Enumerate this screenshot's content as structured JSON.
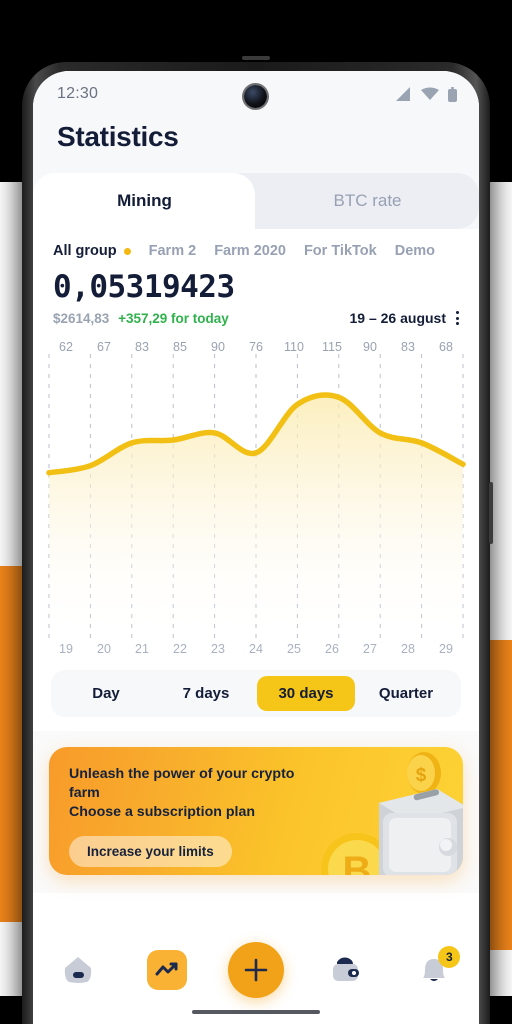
{
  "status_bar": {
    "time": "12:30",
    "signal_icon": "signal-icon",
    "wifi_icon": "wifi-icon",
    "battery_icon": "battery-icon"
  },
  "header": {
    "title": "Statistics"
  },
  "tabs": [
    {
      "label": "Mining",
      "active": true
    },
    {
      "label": "BTC rate",
      "active": false
    }
  ],
  "groups": [
    {
      "label": "All group",
      "active": true
    },
    {
      "label": "Farm 2",
      "active": false
    },
    {
      "label": "Farm 2020",
      "active": false
    },
    {
      "label": "For TikTok",
      "active": false
    },
    {
      "label": "Demo",
      "active": false
    }
  ],
  "balance": {
    "amount": "0,05319423",
    "fiat": "$2614,83",
    "delta": "+357,29 for today",
    "delta_color": "#2fb24c"
  },
  "date_range": {
    "label": "19 – 26 august",
    "menu_icon": "kebab-menu-icon"
  },
  "chart_data": {
    "type": "area",
    "title": "",
    "xlabel": "",
    "ylabel": "",
    "categories": [
      "19",
      "20",
      "21",
      "22",
      "23",
      "24",
      "25",
      "26",
      "27",
      "28",
      "29"
    ],
    "values": [
      62,
      67,
      83,
      85,
      90,
      76,
      110,
      115,
      90,
      83,
      68
    ],
    "point_labels": [
      "62",
      "67",
      "83",
      "85",
      "90",
      "76",
      "110",
      "115",
      "90",
      "83",
      "68"
    ],
    "ylim": [
      0,
      130
    ],
    "grid": "vertical-dashed",
    "legend": "none",
    "line_color": "#f2c014",
    "fill_color": "#fdf6e0",
    "series": [
      {
        "name": "Mining",
        "values": [
          62,
          67,
          83,
          85,
          90,
          76,
          110,
          115,
          90,
          83,
          68
        ]
      }
    ]
  },
  "periods": [
    {
      "label": "Day",
      "active": false
    },
    {
      "label": "7 days",
      "active": false
    },
    {
      "label": "30 days",
      "active": true
    },
    {
      "label": "Quarter",
      "active": false
    }
  ],
  "banner": {
    "line1": "Unleash the power of your crypto farm",
    "line2": "Choose a subscription plan",
    "button": "Increase your limits",
    "art_icon": "safe-vault-with-coins-illustration"
  },
  "bottom_nav": [
    {
      "name": "home-icon",
      "label": ""
    },
    {
      "name": "statistics-chart-icon",
      "label": ""
    },
    {
      "name": "add-plus-icon",
      "label": ""
    },
    {
      "name": "wallet-icon",
      "label": ""
    },
    {
      "name": "notifications-bell-icon",
      "label": "",
      "badge": "3"
    }
  ],
  "theme": {
    "accent_yellow": "#f5c518",
    "accent_orange": "#f2a218",
    "navy": "#141d38",
    "muted": "#98a1b3"
  }
}
